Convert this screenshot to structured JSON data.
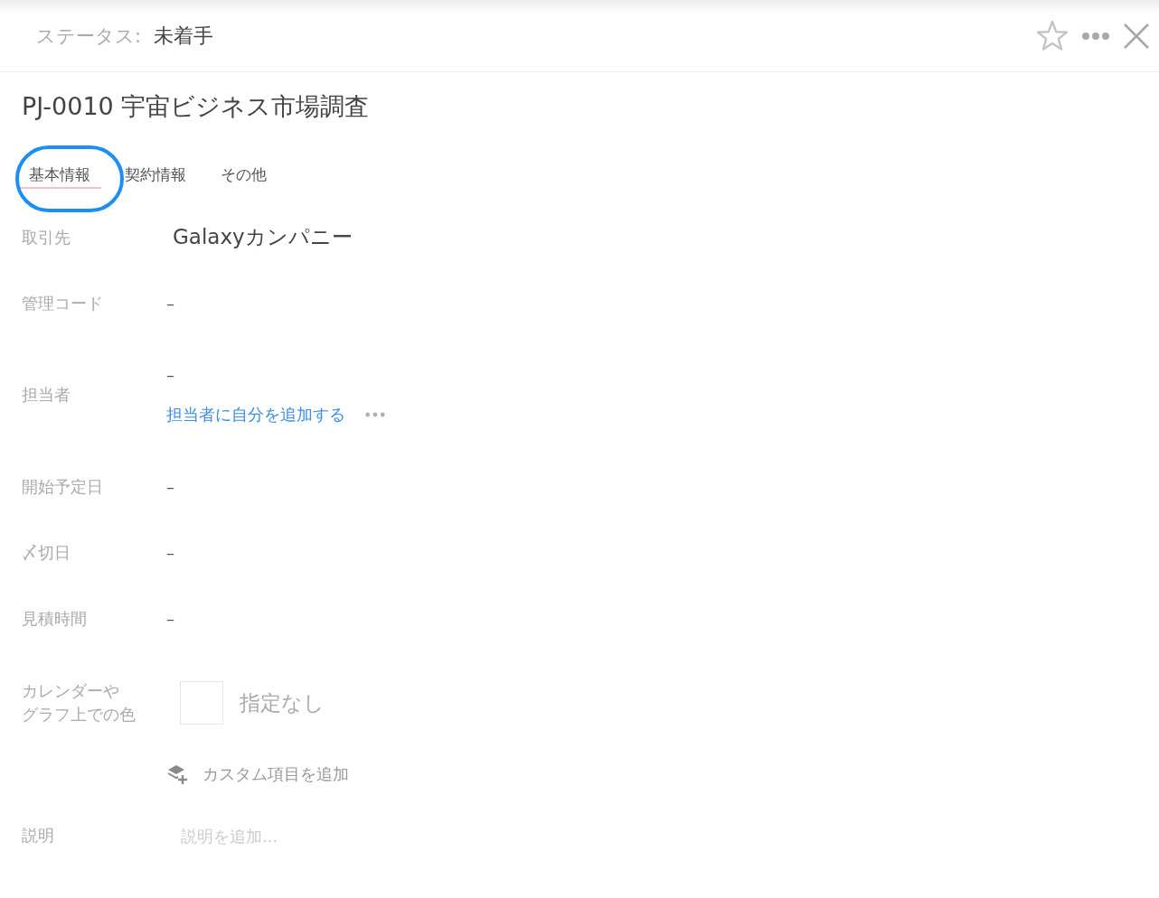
{
  "header": {
    "status_label": "ステータス:",
    "status_value": "未着手",
    "starred": false
  },
  "title": "PJ-0010 宇宙ビジネス市場調査",
  "tabs": [
    {
      "label": "基本情報",
      "selected": true,
      "circled": true
    },
    {
      "label": "契約情報",
      "selected": false,
      "circled": false
    },
    {
      "label": "その他",
      "selected": false,
      "circled": false
    }
  ],
  "fields": [
    {
      "kind": "primary",
      "label": "取引先",
      "value": "Galaxyカンパニー"
    },
    {
      "kind": "text",
      "label": "管理コード",
      "value": "–"
    },
    {
      "kind": "assignee",
      "label": "担当者",
      "value": "–",
      "link": "担当者に自分を追加する"
    },
    {
      "kind": "text",
      "label": "開始予定日",
      "value": "–"
    },
    {
      "kind": "text",
      "label": "〆切日",
      "value": "–"
    },
    {
      "kind": "text",
      "label": "見積時間",
      "value": "–"
    },
    {
      "kind": "color",
      "label_lines": [
        "カレンダーや",
        "グラフ上での色"
      ],
      "value": "指定なし"
    },
    {
      "kind": "action",
      "button_label": "カスタム項目を追加"
    },
    {
      "kind": "description",
      "label": "説明",
      "placeholder": "説明を追加..."
    }
  ]
}
